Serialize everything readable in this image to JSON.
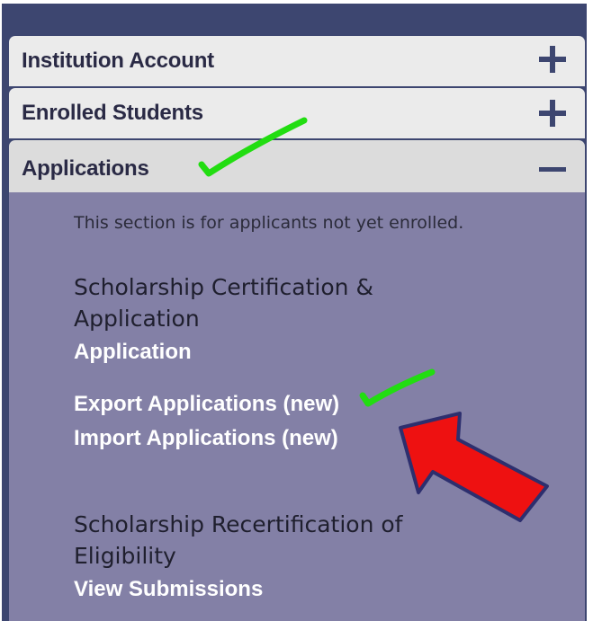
{
  "accordion": {
    "institution_account": {
      "label": "Institution Account",
      "toggle": "plus-icon"
    },
    "enrolled_students": {
      "label": "Enrolled Students",
      "toggle": "plus-icon"
    },
    "applications": {
      "label": "Applications",
      "toggle": "minus-icon"
    }
  },
  "applications_section": {
    "note": "This section is for applicants not yet enrolled.",
    "certification": {
      "title": "Scholarship Certification & Application",
      "links": [
        "Application",
        "Export Applications (new)",
        "Import Applications (new)"
      ]
    },
    "recertification": {
      "title": "Scholarship Recertification of Eligibility",
      "links": [
        "View Submissions"
      ]
    }
  },
  "colors": {
    "background": "#3d4670",
    "header": "#ebebeb",
    "header_active": "#dcdcdc",
    "body": "#8380a6",
    "link": "#ffffff",
    "annotation_check": "#22dd11",
    "annotation_arrow": "#ee1111",
    "annotation_arrow_outline": "#2d2f6e"
  },
  "annotations": {
    "checkmark_icons": [
      "checkmark-icon",
      "checkmark-icon"
    ],
    "arrow_icon": "arrow-pointer-icon"
  }
}
